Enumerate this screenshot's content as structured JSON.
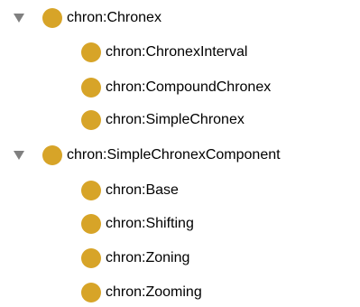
{
  "colors": {
    "class_icon": "#D7A428",
    "toggle": "#808080",
    "text": "#000000"
  },
  "tree": {
    "nodes": [
      {
        "id": "chronex",
        "label": "chron:Chronex",
        "icon": "class-circle-icon",
        "expanded": true,
        "children": [
          {
            "id": "chronex-interval",
            "label": "chron:ChronexInterval",
            "icon": "class-circle-icon"
          },
          {
            "id": "compound-chronex",
            "label": "chron:CompoundChronex",
            "icon": "class-circle-icon"
          },
          {
            "id": "simple-chronex",
            "label": "chron:SimpleChronex",
            "icon": "class-circle-icon"
          }
        ]
      },
      {
        "id": "simple-chronex-component",
        "label": "chron:SimpleChronexComponent",
        "icon": "class-circle-icon",
        "expanded": true,
        "children": [
          {
            "id": "base",
            "label": "chron:Base",
            "icon": "class-circle-icon"
          },
          {
            "id": "shifting",
            "label": "chron:Shifting",
            "icon": "class-circle-icon"
          },
          {
            "id": "zoning",
            "label": "chron:Zoning",
            "icon": "class-circle-icon"
          },
          {
            "id": "zooming",
            "label": "chron:Zooming",
            "icon": "class-circle-icon"
          }
        ]
      }
    ]
  }
}
